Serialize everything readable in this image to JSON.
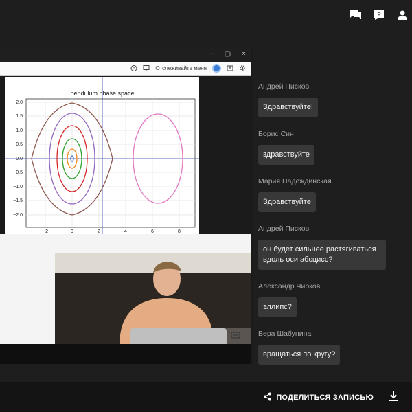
{
  "top_icons": [
    "chat-icon",
    "help-icon",
    "user-icon"
  ],
  "window_controls": [
    "–",
    "▢",
    "×"
  ],
  "browser_toolbar": {
    "follow_me_label": "Отслеживайте меня"
  },
  "plot": {
    "title": "pendulum phase space",
    "y_ticks": [
      "2.0",
      "1.5",
      "1.0",
      "0.5",
      "0.0",
      "−0.5",
      "−1.0",
      "−1.5",
      "−2.0"
    ],
    "x_ticks": [
      "−2",
      "0",
      "2",
      "4",
      "6",
      "8"
    ]
  },
  "chat": [
    {
      "author": "Андрей Писков",
      "text": "Здравствуйте!"
    },
    {
      "author": "Борис Син",
      "text": "здравствуйте"
    },
    {
      "author": "Мария Надеждинская",
      "text": "Здравствуйте"
    },
    {
      "author": "Андрей Писков",
      "text": "он будет сильнее растягиваться вдоль оси абсцисс?"
    },
    {
      "author": "Александр Чирков",
      "text": "эллипс?"
    },
    {
      "author": "Вера Шабунина",
      "text": "вращаться по кругу?"
    }
  ],
  "bottom_bar": {
    "share_label": "ПОДЕЛИТЬСЯ ЗАПИСЬЮ"
  },
  "colors": {
    "background": "#1e1e1e",
    "bubble": "#383838",
    "author_text": "#a4a4a4"
  }
}
